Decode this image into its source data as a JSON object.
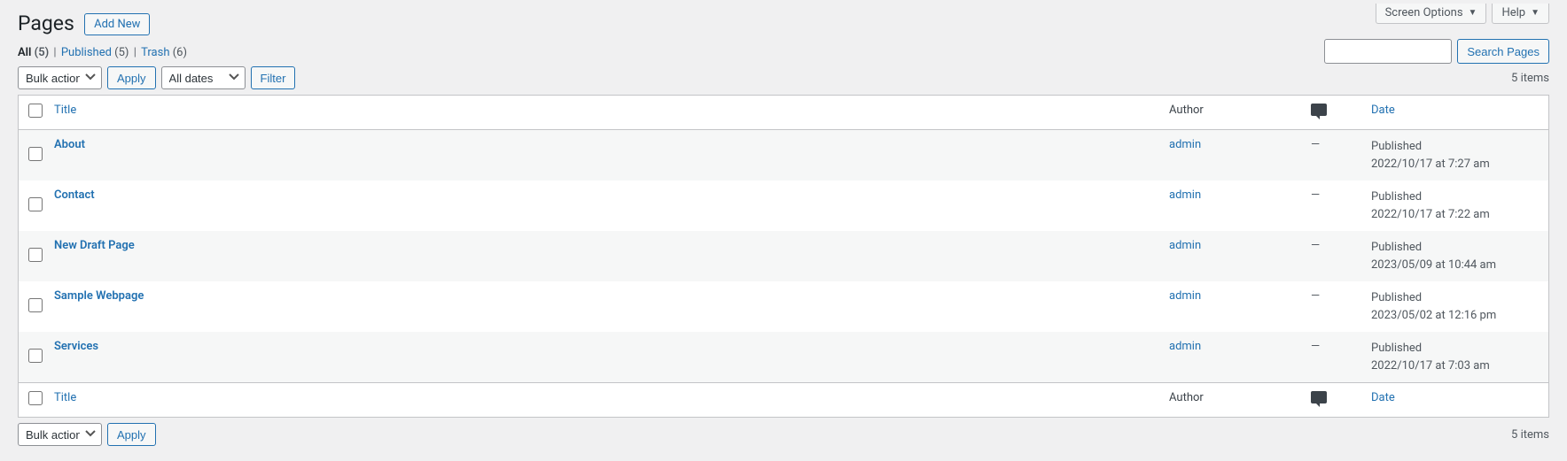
{
  "topnav": {
    "screen_options": "Screen Options",
    "help": "Help"
  },
  "heading": "Pages",
  "add_new": "Add New",
  "views": {
    "all_label": "All",
    "all_count": "(5)",
    "published_label": "Published",
    "published_count": "(5)",
    "trash_label": "Trash",
    "trash_count": "(6)"
  },
  "search": {
    "button": "Search Pages"
  },
  "bulk": {
    "label": "Bulk actions",
    "apply": "Apply"
  },
  "dates": {
    "label": "All dates",
    "filter": "Filter"
  },
  "count_text": "5 items",
  "columns": {
    "title": "Title",
    "author": "Author",
    "date": "Date"
  },
  "rows": [
    {
      "title": "About",
      "author": "admin",
      "comments": "—",
      "status": "Published",
      "date": "2022/10/17 at 7:27 am"
    },
    {
      "title": "Contact",
      "author": "admin",
      "comments": "—",
      "status": "Published",
      "date": "2022/10/17 at 7:22 am"
    },
    {
      "title": "New Draft Page",
      "author": "admin",
      "comments": "—",
      "status": "Published",
      "date": "2023/05/09 at 10:44 am"
    },
    {
      "title": "Sample Webpage",
      "author": "admin",
      "comments": "—",
      "status": "Published",
      "date": "2023/05/02 at 12:16 pm"
    },
    {
      "title": "Services",
      "author": "admin",
      "comments": "—",
      "status": "Published",
      "date": "2022/10/17 at 7:03 am"
    }
  ]
}
